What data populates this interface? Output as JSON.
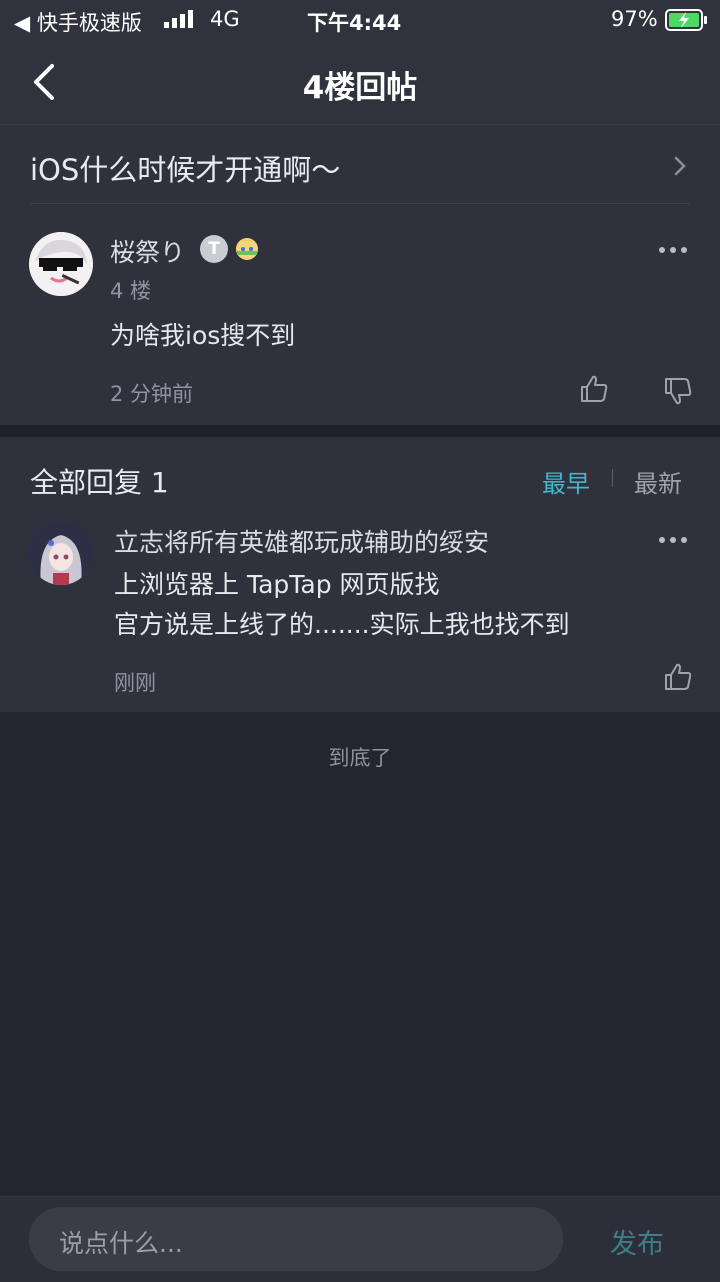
{
  "status_bar": {
    "back_app": "◀ 快手极速版",
    "network": "4G",
    "time": "下午4:44",
    "battery": "97%"
  },
  "nav": {
    "title": "4楼回帖"
  },
  "topic": {
    "title": "iOS什么时候才开通啊～"
  },
  "post": {
    "username": "桜祭り",
    "badge_letter": "T",
    "floor": "4 楼",
    "content": "为啥我ios搜不到",
    "time": "2 分钟前"
  },
  "replies": {
    "header": "全部回复 1",
    "sort_earliest": "最早",
    "sort_newest": "最新",
    "items": [
      {
        "username": "立志将所有英雄都玩成辅助的绥安",
        "line1": "上浏览器上 TapTap 网页版找",
        "line2": "官方说是上线了的.......实际上我也找不到",
        "time": "刚刚"
      }
    ]
  },
  "end_text": "到底了",
  "composer": {
    "placeholder": "说点什么...",
    "publish_label": "发布"
  },
  "colors": {
    "accent": "#3fb8c9",
    "background": "#23252f",
    "card": "#2f323c"
  }
}
